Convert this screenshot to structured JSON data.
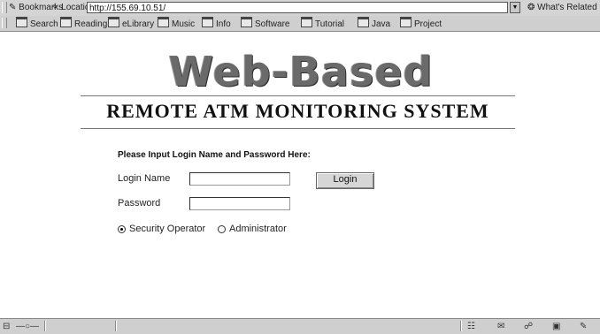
{
  "browser": {
    "bookmarks_label": "Bookmarks",
    "location_label": "Location:",
    "url": "http://155.69.10.51/",
    "whats_related": "What's Related",
    "personal_toolbar": [
      "Search",
      "Reading",
      "eLibrary",
      "Music",
      "Info",
      "Software",
      "Tutorial",
      "Java",
      "Project"
    ]
  },
  "page": {
    "logo_title": "Web-Based",
    "banner": "REMOTE ATM MONITORING SYSTEM"
  },
  "login_form": {
    "heading": "Please Input Login Name and Password Here:",
    "login_name_label": "Login Name",
    "login_name_value": "",
    "password_label": "Password",
    "password_value": "",
    "login_button": "Login",
    "roles": [
      {
        "label": "Security Operator",
        "selected": true
      },
      {
        "label": "Administrator",
        "selected": false
      }
    ]
  }
}
